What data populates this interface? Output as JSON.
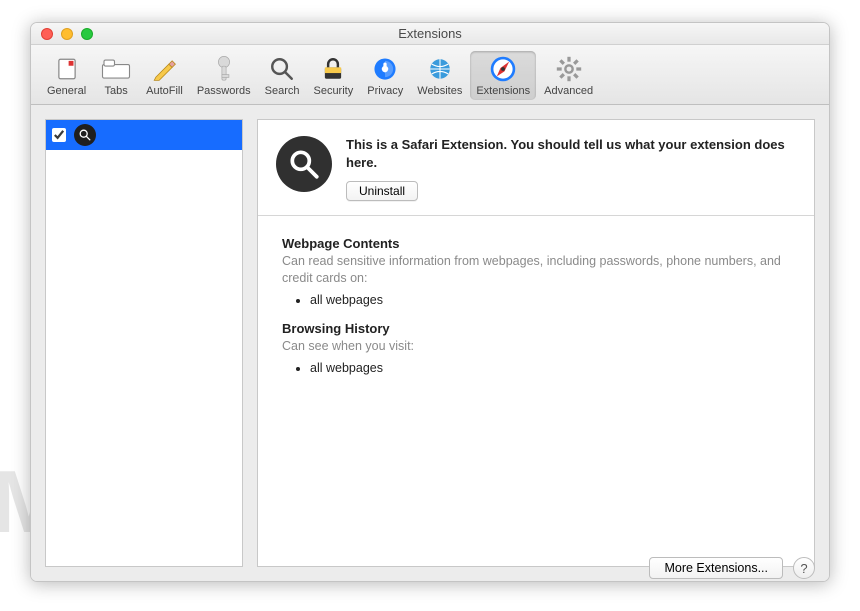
{
  "window": {
    "title": "Extensions"
  },
  "toolbar": {
    "items": [
      {
        "label": "General"
      },
      {
        "label": "Tabs"
      },
      {
        "label": "AutoFill"
      },
      {
        "label": "Passwords"
      },
      {
        "label": "Search"
      },
      {
        "label": "Security"
      },
      {
        "label": "Privacy"
      },
      {
        "label": "Websites"
      },
      {
        "label": "Extensions"
      },
      {
        "label": "Advanced"
      }
    ]
  },
  "detail": {
    "headline": "This is a Safari Extension. You should tell us what your extension does here.",
    "uninstall_label": "Uninstall",
    "sections": {
      "webpage_title": "Webpage Contents",
      "webpage_desc": "Can read sensitive information from webpages, including passwords, phone numbers, and credit cards on:",
      "webpage_item": "all webpages",
      "history_title": "Browsing History",
      "history_desc": "Can see when you visit:",
      "history_item": "all webpages"
    }
  },
  "footer": {
    "more_label": "More Extensions...",
    "help_label": "?"
  },
  "watermark": "MALWARETIPS"
}
